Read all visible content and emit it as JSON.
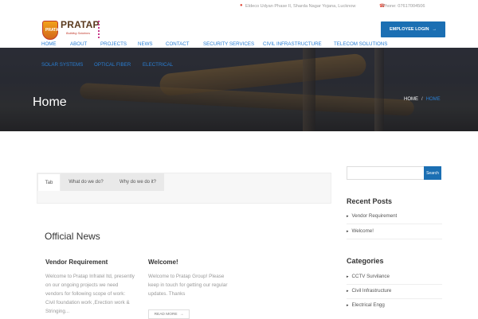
{
  "topbar": {
    "address": "Eldeco Udyan Phase II, Sharda Nagar Yojana, Lucknow",
    "phone": "Phone: 07617004506"
  },
  "logo": {
    "brand": "PRATAP",
    "tagline": "Building Solutions",
    "mark": "PRATAP"
  },
  "header": {
    "employee_login": "EMPLOYEE LOGIN",
    "arrow": "→"
  },
  "nav": {
    "items": [
      "HOME",
      "ABOUT",
      "PROJECTS",
      "NEWS",
      "CONTACT",
      "SECURITY SERVICES",
      "CIVIL INFRASTRUCTURE",
      "TELECOM SOLUTIONS",
      "SOLAR SYSTEMS",
      "OPTICAL FIBER",
      "ELECTRICAL"
    ]
  },
  "hero": {
    "title": "Home",
    "breadcrumb_home": "HOME",
    "breadcrumb_sep": "/",
    "breadcrumb_current": "HOME"
  },
  "tabs": [
    "Tab",
    "What do we do?",
    "Why do we do it?"
  ],
  "news": {
    "heading": "Official News",
    "cards": [
      {
        "title": "Vendor Requirement",
        "text": "Welcome to Pratap Infratel ltd, presently on our ongoing projects we need vendors for following scope of work: Civil foundation work ,Erection work & Stringing..."
      },
      {
        "title": "Welcome!",
        "text": "Welcome to Pratap Group! Please keep in touch for getting our regular updates. Thanks"
      }
    ],
    "read_more": "READ MORE",
    "read_more_arrow": "→"
  },
  "sidebar": {
    "search_button": "Search",
    "recent_heading": "Recent Posts",
    "recent": [
      "Vendor Requirement",
      "Welcome!"
    ],
    "categories_heading": "Categories",
    "categories": [
      "CCTV Survilance",
      "Civil Infrastructure",
      "Electrical Engg"
    ]
  },
  "colors": {
    "accent": "#1b6fb3",
    "link": "#2a7fd4",
    "icon_red": "#e04a3a"
  }
}
